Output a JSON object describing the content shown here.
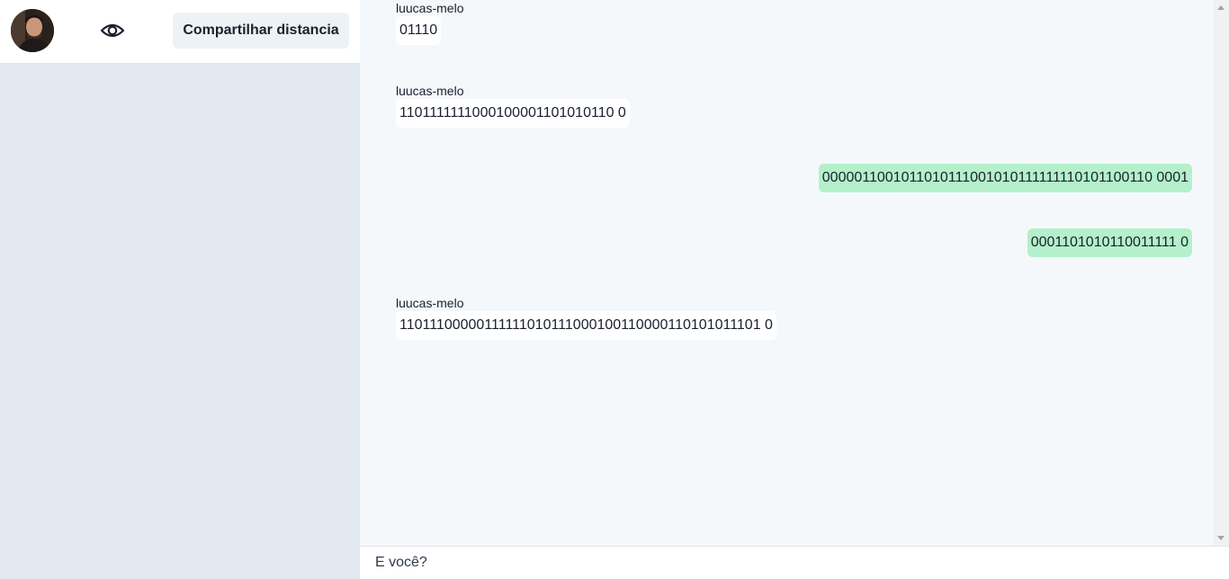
{
  "sidebar": {
    "avatar_icon": "user-avatar",
    "eye_icon": "eye-icon",
    "share_label": "Compartilhar distancia"
  },
  "chat": {
    "messages": [
      {
        "sender": "luucas-melo",
        "text": "01110",
        "direction": "incoming"
      },
      {
        "sender": "luucas-melo",
        "text": "1101111111000100001101010110 0",
        "direction": "incoming"
      },
      {
        "sender": "",
        "text": "0000011001011010111001010111111110101100110 0001",
        "direction": "outgoing"
      },
      {
        "sender": "",
        "text": "0001101010110011111 0",
        "direction": "outgoing"
      },
      {
        "sender": "luucas-melo",
        "text": "11011100000111111010111000100110000110101011101 0",
        "direction": "incoming"
      }
    ]
  },
  "composer": {
    "placeholder": "E você?"
  },
  "colors": {
    "sidebar_bg": "#e2e8f0",
    "chat_bg": "#f5f8fb",
    "incoming_bubble": "#ffffff",
    "outgoing_bubble": "#b4f0cb"
  }
}
